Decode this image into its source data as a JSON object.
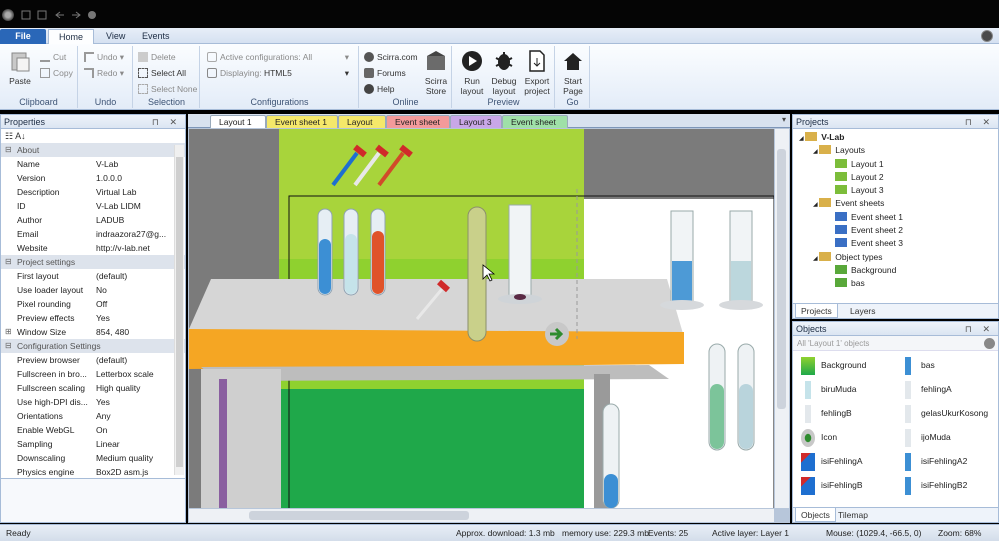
{
  "ribbon": {
    "tabs": [
      "File",
      "Home",
      "View",
      "Events"
    ],
    "clipboard": {
      "label": "Clipboard",
      "paste": "Paste",
      "cut": "Cut",
      "copy": "Copy"
    },
    "undo": {
      "label": "Undo",
      "undo": "Undo",
      "redo": "Redo"
    },
    "selection": {
      "label": "Selection",
      "delete": "Delete",
      "select_all": "Select All",
      "select_none": "Select None"
    },
    "configurations": {
      "label": "Configurations",
      "active_label": "Active configurations:",
      "active_value": "All",
      "displaying_label": "Displaying:",
      "displaying_value": "HTML5"
    },
    "online": {
      "label": "Online",
      "scirra": "Scirra.com",
      "forums": "Forums",
      "help": "Help",
      "store_line1": "Scirra",
      "store_line2": "Store"
    },
    "preview": {
      "label": "Preview",
      "run_line1": "Run",
      "run_line2": "layout",
      "debug_line1": "Debug",
      "debug_line2": "layout",
      "export_line1": "Export",
      "export_line2": "project"
    },
    "go": {
      "label": "Go",
      "start_line1": "Start",
      "start_line2": "Page"
    }
  },
  "properties": {
    "title": "Properties",
    "rows": [
      {
        "k": "About",
        "cat": true
      },
      {
        "k": "Name",
        "v": "V-Lab"
      },
      {
        "k": "Version",
        "v": "1.0.0.0"
      },
      {
        "k": "Description",
        "v": "Virtual Lab"
      },
      {
        "k": "ID",
        "v": "V-Lab LIDM"
      },
      {
        "k": "Author",
        "v": "LADUB"
      },
      {
        "k": "Email",
        "v": "indraazora27@g..."
      },
      {
        "k": "Website",
        "v": "http://v-lab.net"
      },
      {
        "k": "Project settings",
        "cat": true
      },
      {
        "k": "First layout",
        "v": "(default)"
      },
      {
        "k": "Use loader layout",
        "v": "No"
      },
      {
        "k": "Pixel rounding",
        "v": "Off"
      },
      {
        "k": "Preview effects",
        "v": "Yes"
      },
      {
        "k": "Window Size",
        "v": "854, 480",
        "exp": true
      },
      {
        "k": "Configuration Settings",
        "cat": true
      },
      {
        "k": "Preview browser",
        "v": "(default)"
      },
      {
        "k": "Fullscreen in bro...",
        "v": "Letterbox scale"
      },
      {
        "k": "Fullscreen scaling",
        "v": "High quality"
      },
      {
        "k": "Use high-DPI dis...",
        "v": "Yes"
      },
      {
        "k": "Orientations",
        "v": "Any"
      },
      {
        "k": "Enable WebGL",
        "v": "On"
      },
      {
        "k": "Sampling",
        "v": "Linear"
      },
      {
        "k": "Downscaling",
        "v": "Medium quality"
      },
      {
        "k": "Physics engine",
        "v": "Box2D asm.js"
      }
    ]
  },
  "doc_tabs": [
    {
      "label": "Layout 1",
      "color": "#dce6f4",
      "active": true
    },
    {
      "label": "Event sheet 1",
      "color": "#f5e86a"
    },
    {
      "label": "Layout 2",
      "color": "#f5e86a"
    },
    {
      "label": "Event sheet 2",
      "color": "#f39a9a"
    },
    {
      "label": "Layout 3",
      "color": "#c9a7e8"
    },
    {
      "label": "Event sheet 3",
      "color": "#9fe0a8"
    }
  ],
  "projects": {
    "title": "Projects",
    "tree": [
      {
        "label": "V-Lab",
        "lvl": 0,
        "icon": "folder",
        "bold": true
      },
      {
        "label": "Layouts",
        "lvl": 1,
        "icon": "folder"
      },
      {
        "label": "Layout 1",
        "lvl": 2,
        "icon": "layout"
      },
      {
        "label": "Layout 2",
        "lvl": 2,
        "icon": "layout"
      },
      {
        "label": "Layout 3",
        "lvl": 2,
        "icon": "layout"
      },
      {
        "label": "Event sheets",
        "lvl": 1,
        "icon": "folder"
      },
      {
        "label": "Event sheet 1",
        "lvl": 2,
        "icon": "events"
      },
      {
        "label": "Event sheet 2",
        "lvl": 2,
        "icon": "events"
      },
      {
        "label": "Event sheet 3",
        "lvl": 2,
        "icon": "events"
      },
      {
        "label": "Object types",
        "lvl": 1,
        "icon": "folder"
      },
      {
        "label": "Background",
        "lvl": 2,
        "icon": "sprite"
      },
      {
        "label": "bas",
        "lvl": 2,
        "icon": "sprite"
      }
    ],
    "tabs": [
      "Projects",
      "Layers"
    ]
  },
  "objects": {
    "title": "Objects",
    "filter": "All 'Layout 1' objects",
    "items": [
      {
        "label": "Background",
        "icon": "bg"
      },
      {
        "label": "bas",
        "icon": "tube-blue"
      },
      {
        "label": "biruMuda",
        "icon": "tube-light"
      },
      {
        "label": "fehlingA",
        "icon": "tube-empty"
      },
      {
        "label": "fehlingB",
        "icon": "tube-empty"
      },
      {
        "label": "gelasUkurKosong",
        "icon": "tube-empty"
      },
      {
        "label": "Icon",
        "icon": "arrow"
      },
      {
        "label": "ijoMuda",
        "icon": "tube-empty"
      },
      {
        "label": "isiFehlingA",
        "icon": "dropper"
      },
      {
        "label": "isiFehlingA2",
        "icon": "tube-blue"
      },
      {
        "label": "isiFehlingB",
        "icon": "dropper"
      },
      {
        "label": "isiFehlingB2",
        "icon": "tube-blue"
      }
    ],
    "tabs": [
      "Objects",
      "Tilemap"
    ]
  },
  "status": {
    "ready": "Ready",
    "download": "Approx. download: 1.3 mb",
    "memory": "memory use: 229.3 mb",
    "events": "Events: 25",
    "layer": "Active layer: Layer 1",
    "mouse": "Mouse: (1029.4, -66.5, 0)",
    "zoom": "Zoom: 68%"
  }
}
